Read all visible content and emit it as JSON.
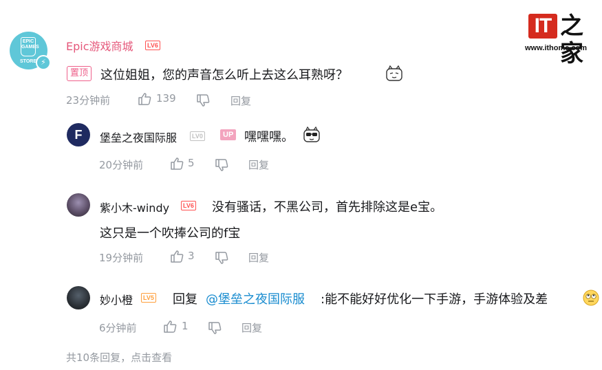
{
  "watermark": {
    "logo_text": "IT",
    "logo_chars": "之家",
    "url": "www.ithome.com"
  },
  "comment": {
    "author": "Epic游戏商城",
    "level": "LV6",
    "avatar_text_top": "EPIC GAMES",
    "avatar_text_bottom": "STORE",
    "pinned_label": "置顶",
    "text": "这位姐姐，您的声音怎么听上去这么耳熟呀？",
    "time": "23分钟前",
    "likes": "139",
    "reply_label": "回复"
  },
  "replies": [
    {
      "author": "堡垒之夜国际服",
      "level": "LV0",
      "up_label": "UP",
      "avatar_text": "F",
      "text": "嘿嘿嘿。",
      "time": "20分钟前",
      "likes": "5",
      "reply_label": "回复"
    },
    {
      "author": "紫小木-windy",
      "level": "LV6",
      "text_line1": "没有骚话，不黑公司，首先排除这是e宝。",
      "text_line2": "这只是一个吹捧公司的f宝",
      "time": "19分钟前",
      "likes": "3",
      "reply_label": "回复"
    },
    {
      "author": "妙小橙",
      "level": "LV5",
      "reply_prefix": "回复",
      "mention": "@堡垒之夜国际服",
      "text": ":能不能好好优化一下手游，手游体验及差",
      "time": "6分钟前",
      "likes": "1",
      "reply_label": "回复"
    }
  ],
  "more_replies": "共10条回复，点击查看",
  "colors": {
    "author_main": "#e5577a",
    "mention": "#178bcf",
    "meta": "#9499a0",
    "lv6": "#ff5050",
    "lv5": "#ff9f3c",
    "up_badge": "#f3a4be",
    "logo_red": "#d52b1e"
  }
}
